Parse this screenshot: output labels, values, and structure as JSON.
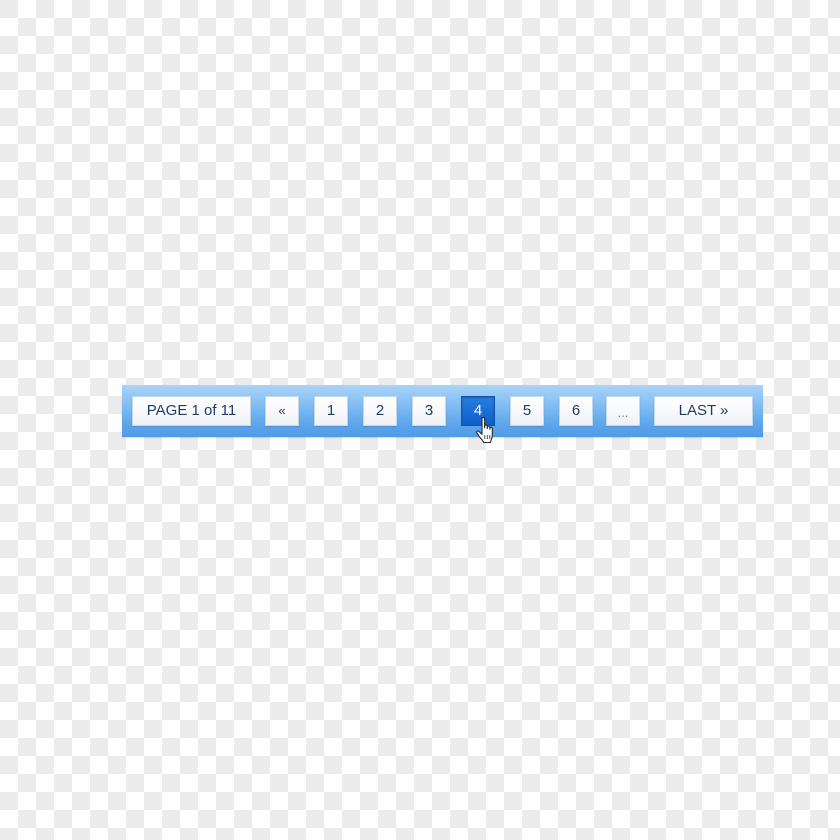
{
  "pagination": {
    "page_label": "PAGE 1 of 11",
    "first_label": "«",
    "pages": [
      "1",
      "2",
      "3",
      "4",
      "5",
      "6"
    ],
    "active_page": "4",
    "ellipsis_label": "...",
    "last_label": "LAST »",
    "current_page": 1,
    "total_pages": 11
  },
  "cursor": {
    "icon": "hand-pointer-icon"
  },
  "colors": {
    "bar_top": "#aad4f9",
    "bar_bottom": "#4f9be8",
    "active_button": "#1a6fd6",
    "text": "#223a66"
  }
}
